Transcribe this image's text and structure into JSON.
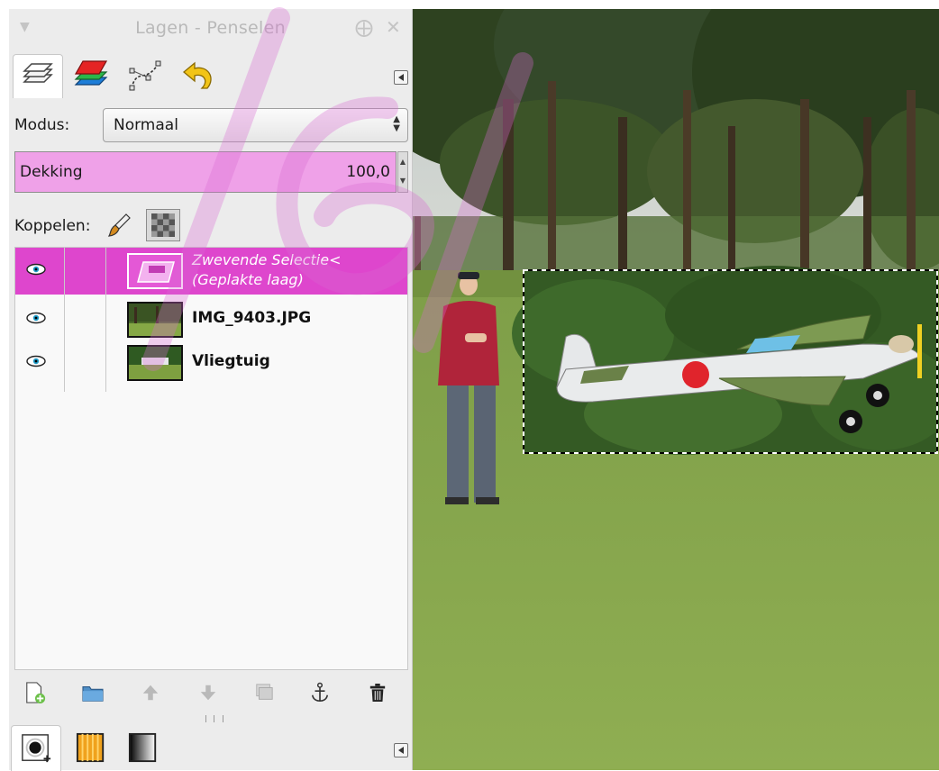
{
  "dialog": {
    "title": "Lagen - Penselen",
    "tabs": [
      {
        "name": "layers",
        "icon": "layers-icon"
      },
      {
        "name": "channels",
        "icon": "channels-icon"
      },
      {
        "name": "paths",
        "icon": "paths-icon"
      },
      {
        "name": "undo-history",
        "icon": "undo-icon"
      }
    ]
  },
  "mode": {
    "label": "Modus:",
    "value": "Normaal"
  },
  "opacity": {
    "label": "Dekking",
    "value": "100,0",
    "fill_fraction": 1.0,
    "color": "#efa1e8"
  },
  "lock": {
    "label": "Koppelen:"
  },
  "layers": [
    {
      "name_line1": "Zwevende Selectie<",
      "name_line2": "(Geplakte laag)",
      "visible": true,
      "selected": true,
      "floating": true
    },
    {
      "name": "IMG_9403.JPG",
      "visible": true,
      "selected": false
    },
    {
      "name": "Vliegtuig",
      "visible": true,
      "selected": false
    }
  ],
  "toolbar": [
    {
      "icon": "new-layer-icon"
    },
    {
      "icon": "new-layer-group-icon"
    },
    {
      "icon": "raise-layer-icon"
    },
    {
      "icon": "lower-layer-icon"
    },
    {
      "icon": "duplicate-layer-icon"
    },
    {
      "icon": "anchor-layer-icon"
    },
    {
      "icon": "delete-layer-icon"
    }
  ],
  "bottom_tabs": [
    {
      "icon": "brushes-icon"
    },
    {
      "icon": "patterns-icon"
    },
    {
      "icon": "gradients-icon"
    }
  ],
  "colors": {
    "selection_highlight": "#de46cd",
    "panel_background": "#ececec",
    "watermark": "#d96ad2"
  }
}
